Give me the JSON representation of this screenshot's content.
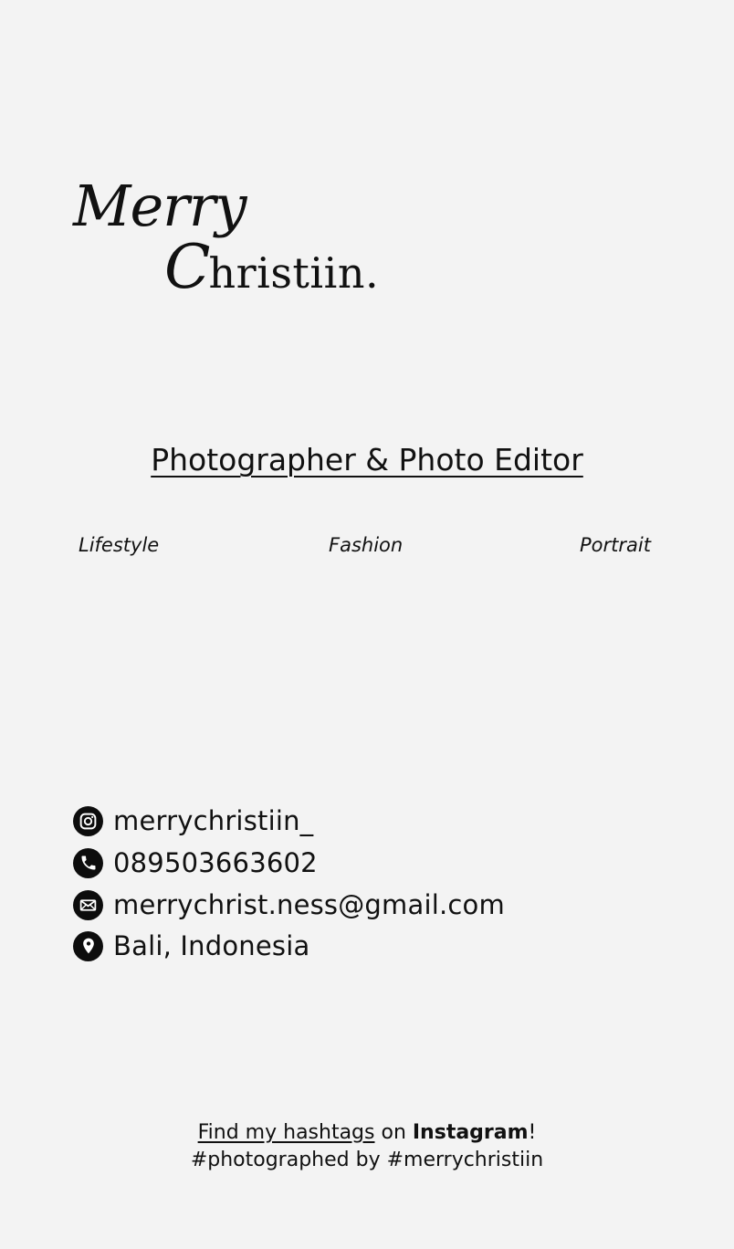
{
  "logo": {
    "line1": "Merry",
    "line2_initial": "C",
    "line2_rest": "hristiin."
  },
  "headline": "Photographer & Photo Editor",
  "specialties": [
    "Lifestyle",
    "Fashion",
    "Portrait"
  ],
  "contacts": [
    {
      "icon": "instagram-icon",
      "text": "merrychristiin_"
    },
    {
      "icon": "phone-icon",
      "text": "089503663602"
    },
    {
      "icon": "mail-icon",
      "text": "merrychrist.ness@gmail.com"
    },
    {
      "icon": "location-pin-icon",
      "text": "Bali, Indonesia"
    }
  ],
  "footer": {
    "link_text": "Find my hashtags",
    "middle": " on ",
    "platform": "Instagram",
    "end": "!",
    "tagline": "#photographed by #merrychristiin"
  },
  "colors": {
    "background": "#f3f3f3",
    "text": "#111111",
    "icon_fill": "#0d0d0d"
  }
}
